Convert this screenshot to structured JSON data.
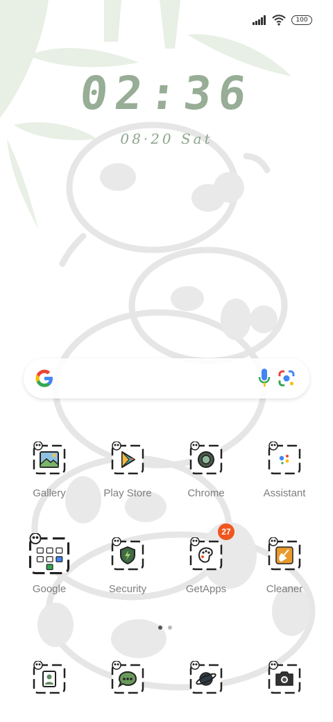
{
  "status_bar": {
    "battery": "100",
    "icons": [
      "signal-icon",
      "wifi-icon",
      "battery-icon"
    ]
  },
  "lockscreen": {
    "time": "02:36",
    "date": "08·20 Sat"
  },
  "search_bar": {
    "icons": [
      "google-icon",
      "mic-icon",
      "lens-icon"
    ]
  },
  "apps_row1": [
    {
      "label": "Gallery",
      "icon": "gallery-icon"
    },
    {
      "label": "Play Store",
      "icon": "play-store-icon"
    },
    {
      "label": "Chrome",
      "icon": "chrome-icon"
    },
    {
      "label": "Assistant",
      "icon": "assistant-icon"
    }
  ],
  "apps_row2": [
    {
      "label": "Google",
      "icon": "google-folder-icon"
    },
    {
      "label": "Security",
      "icon": "security-icon"
    },
    {
      "label": "GetApps",
      "icon": "getapps-icon",
      "badge": "27"
    },
    {
      "label": "Cleaner",
      "icon": "cleaner-icon"
    }
  ],
  "dock": [
    {
      "icon": "contacts-icon"
    },
    {
      "icon": "messages-icon"
    },
    {
      "icon": "browser-icon"
    },
    {
      "icon": "camera-icon"
    }
  ],
  "page_indicator": {
    "pages": 2,
    "current": 1
  },
  "colors": {
    "clock": "#97ad95",
    "badge": "#f0561d",
    "label": "#7d7d7d"
  }
}
